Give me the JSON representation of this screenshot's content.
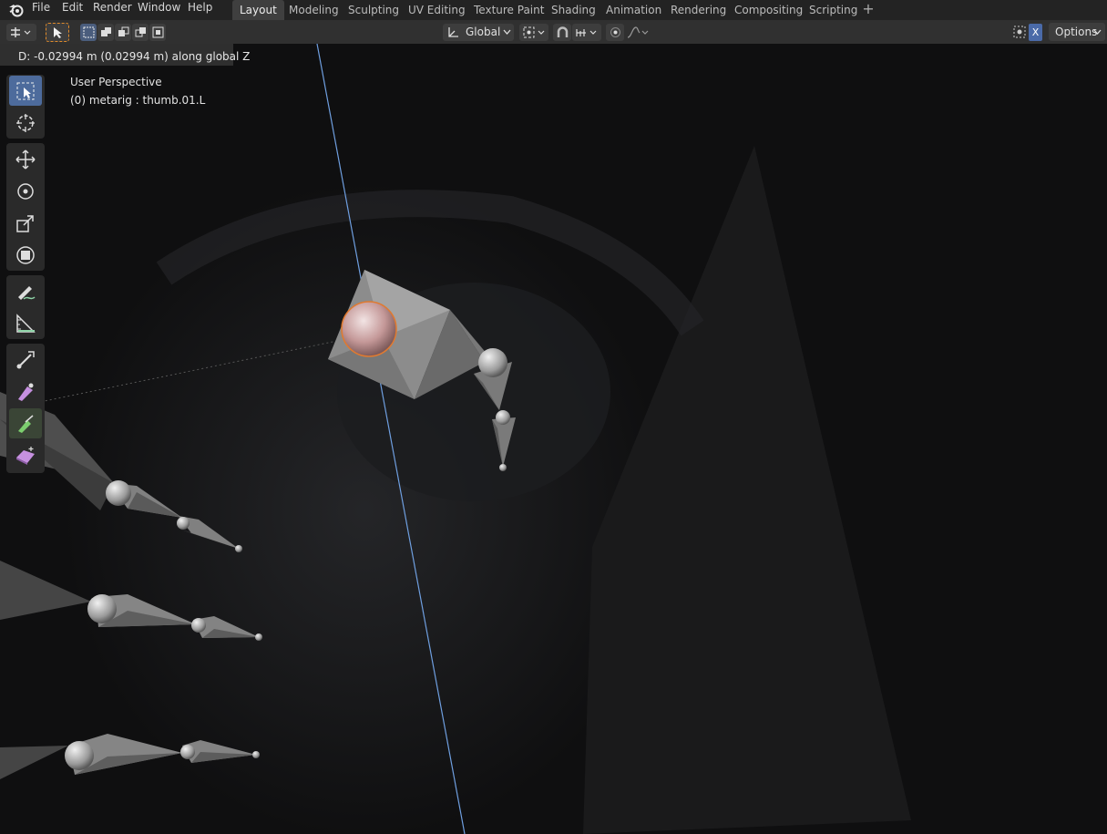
{
  "menu": {
    "items": [
      "File",
      "Edit",
      "Render",
      "Window",
      "Help"
    ]
  },
  "workspaces": {
    "tabs": [
      "Layout",
      "Modeling",
      "Sculpting",
      "UV Editing",
      "Texture Paint",
      "Shading",
      "Animation",
      "Rendering",
      "Compositing",
      "Scripting"
    ],
    "active": "Layout"
  },
  "header": {
    "orientation": "Global",
    "options_label": "Options",
    "xray_label": "X"
  },
  "viewport": {
    "status_text": "D: -0.02994 m (0.02994 m) along global Z",
    "perspective_label": "User Perspective",
    "object_info": "(0) metarig : thumb.01.L"
  },
  "toolbar": {
    "tools": [
      "select-box-icon",
      "cursor-icon",
      "move-icon",
      "rotate-icon",
      "scale-icon",
      "transform-icon",
      "annotate-icon",
      "measure-icon",
      "bone-roll-icon",
      "bone-size-icon",
      "extrude-bone-icon",
      "shear-icon"
    ],
    "active_tool": "select-box-icon"
  },
  "colors": {
    "accent": "#4d6b9c",
    "topbar": "#232323",
    "header": "#303030",
    "viewport_bg": "#0f0f10",
    "axis_line": "#6f9fe0",
    "selected_outline": "#e07a30"
  }
}
